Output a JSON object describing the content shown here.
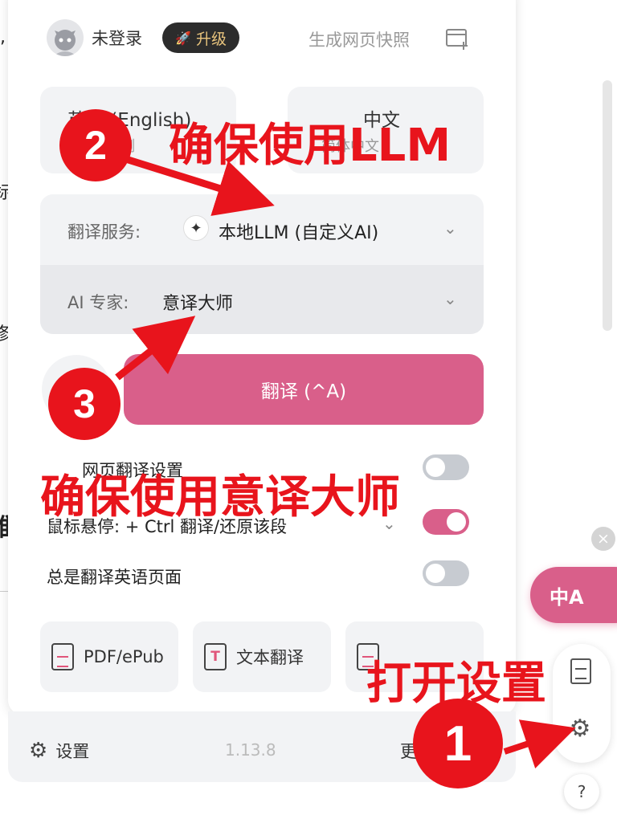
{
  "background": {
    "fragments": [
      ",",
      "标",
      "修",
      "推"
    ]
  },
  "header": {
    "user_name": "未登录",
    "upgrade_label": "升级",
    "snapshot_label": "生成网页快照"
  },
  "languages": {
    "source_label": "英语 (English)",
    "source_sub": "检测",
    "target_label": "中文",
    "target_sub": "简体中文"
  },
  "service": {
    "label": "翻译服务:",
    "value": "本地LLM (自定义AI)"
  },
  "expert": {
    "label": "AI 专家:",
    "value": "意译大师"
  },
  "translate_button": "翻译 (^A)",
  "toggles": [
    {
      "label": "网页翻译设置",
      "on": false
    },
    {
      "label": "鼠标悬停: + Ctrl 翻译/还原该段",
      "on": true
    },
    {
      "label": "总是翻译英语页面",
      "on": false
    }
  ],
  "tools": {
    "pdf": "PDF/ePub",
    "text": "文本翻译"
  },
  "footer": {
    "settings_label": "设置",
    "version": "1.13.8",
    "more_label": "更多"
  },
  "float": {
    "close": "×",
    "translate_label": "中A",
    "help": "?"
  },
  "annotations": {
    "step1_number": "1",
    "step1_text": "打开设置",
    "step2_number": "2",
    "step2_text": "确保使用LLM",
    "step3_number": "3",
    "step3_text": "确保使用意译大师"
  },
  "colors": {
    "accent": "#d95f8a",
    "annotation": "#e8141c"
  },
  "icons": [
    "avatar-icon",
    "rocket-icon",
    "snapshot-icon",
    "ai-sparkle-icon",
    "chevron-down-icon",
    "pdf-doc-icon",
    "text-doc-icon",
    "gear-icon",
    "doc-icon",
    "help-icon"
  ]
}
